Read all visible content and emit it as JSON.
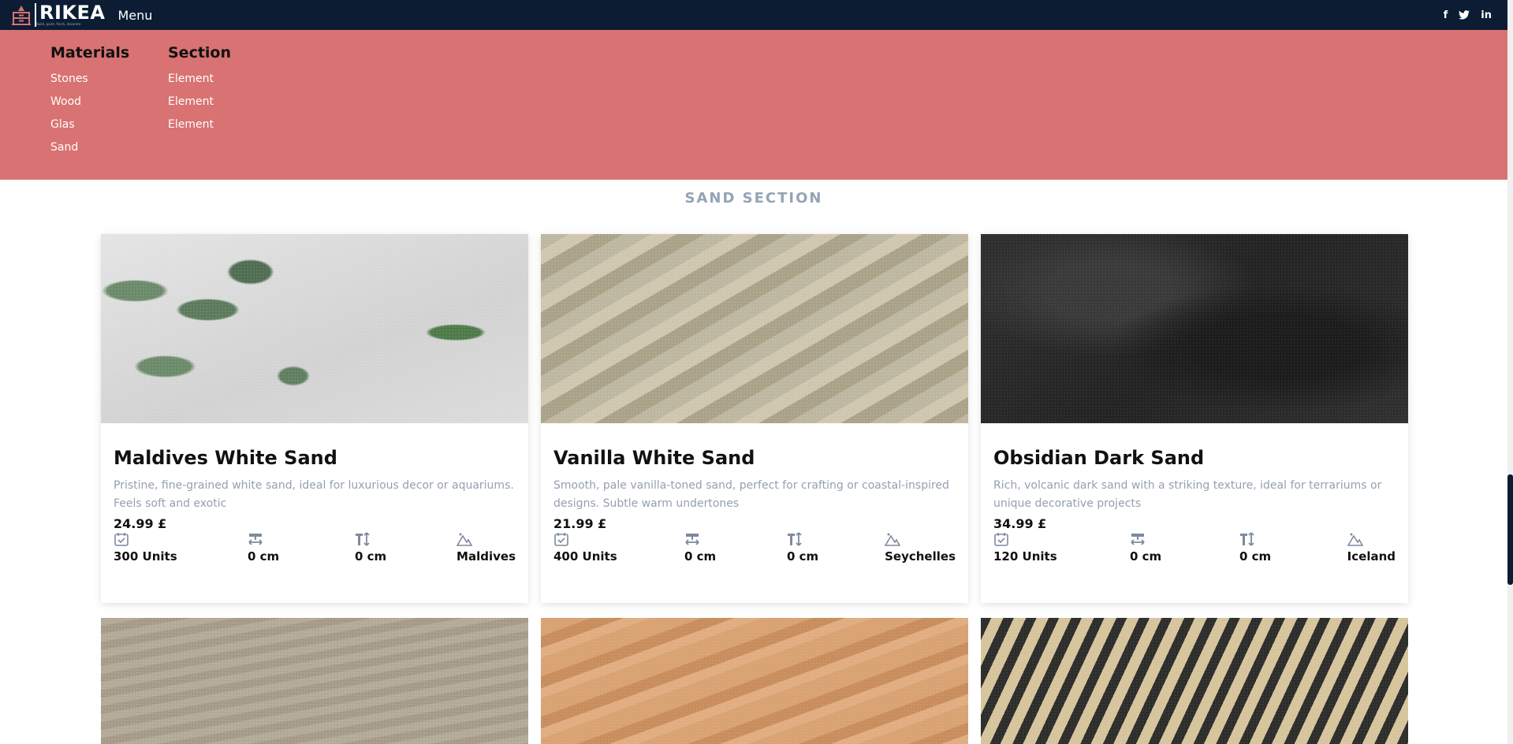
{
  "header": {
    "logo_text": "RIKEA",
    "logo_tagline": "Build, paint, finish, decorate",
    "menu_label": "Menu",
    "social": [
      {
        "icon": "facebook-icon",
        "label": "f"
      },
      {
        "icon": "twitter-icon",
        "label": "t"
      },
      {
        "icon": "linkedin-icon",
        "label": "in"
      }
    ]
  },
  "mega_menu": {
    "materials": {
      "heading": "Materials",
      "items": [
        "Stones",
        "Wood",
        "Glas",
        "Sand"
      ]
    },
    "section": {
      "heading": "Section",
      "items": [
        "Element",
        "Element",
        "Element"
      ]
    }
  },
  "page": {
    "section_title": "SAND SECTION"
  },
  "colors": {
    "navbar": "#0b1c33",
    "mega_menu_bg": "#d97272",
    "muted_text": "#95a3b6"
  },
  "products": [
    {
      "name": "Maldives White Sand",
      "description": "Pristine, fine-grained white sand, ideal for luxurious decor or aquariums. Feels soft and exotic",
      "price": "24.99 £",
      "stock": "300 Units",
      "width": "0 cm",
      "height": "0 cm",
      "origin": "Maldives",
      "image": "white sand with green succulent plants"
    },
    {
      "name": "Vanilla White Sand",
      "description": "Smooth, pale vanilla-toned sand, perfect for crafting or coastal-inspired designs. Subtle warm undertones",
      "price": "21.99 £",
      "stock": "400 Units",
      "width": "0 cm",
      "height": "0 cm",
      "origin": "Seychelles",
      "image": "pale grainy sand with diagonal ripples"
    },
    {
      "name": "Obsidian Dark Sand",
      "description": "Rich, volcanic dark sand with a striking texture, ideal for terrariums or unique decorative projects",
      "price": "34.99 £",
      "stock": "120 Units",
      "width": "0 cm",
      "height": "0 cm",
      "origin": "Iceland",
      "image": "dark volcanic sand"
    }
  ],
  "products_row2": [
    {
      "image": "coarse beige beach sand"
    },
    {
      "image": "orange rippled desert dune"
    },
    {
      "image": "black and gold striped sand ripples"
    }
  ]
}
